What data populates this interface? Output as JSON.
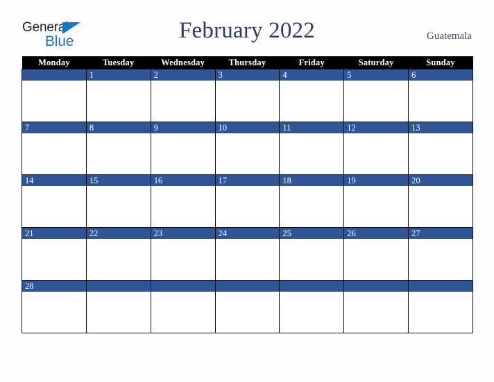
{
  "header": {
    "logo": {
      "word_one": "General",
      "word_two": "Blue",
      "triangle_icon": "triangle-icon"
    },
    "title": "February 2022",
    "subtitle": "Guatemala"
  },
  "calendar": {
    "weekday_headers": [
      "Monday",
      "Tuesday",
      "Wednesday",
      "Thursday",
      "Friday",
      "Saturday",
      "Sunday"
    ],
    "weeks": [
      [
        "",
        "1",
        "2",
        "3",
        "4",
        "5",
        "6"
      ],
      [
        "7",
        "8",
        "9",
        "10",
        "11",
        "12",
        "13"
      ],
      [
        "14",
        "15",
        "16",
        "17",
        "18",
        "19",
        "20"
      ],
      [
        "21",
        "22",
        "23",
        "24",
        "25",
        "26",
        "27"
      ],
      [
        "28",
        "",
        "",
        "",
        "",
        "",
        ""
      ]
    ],
    "colors": {
      "header_background": "#000000",
      "header_text": "#ffffff",
      "daynum_background": "#2f5597",
      "daynum_text": "#ffffff",
      "cell_background": "#ffffff",
      "grid_border": "#0d0d0d",
      "title_text": "#2d3c60",
      "logo_blue": "#1b75bc",
      "page_background": "#fdfdfd"
    }
  }
}
